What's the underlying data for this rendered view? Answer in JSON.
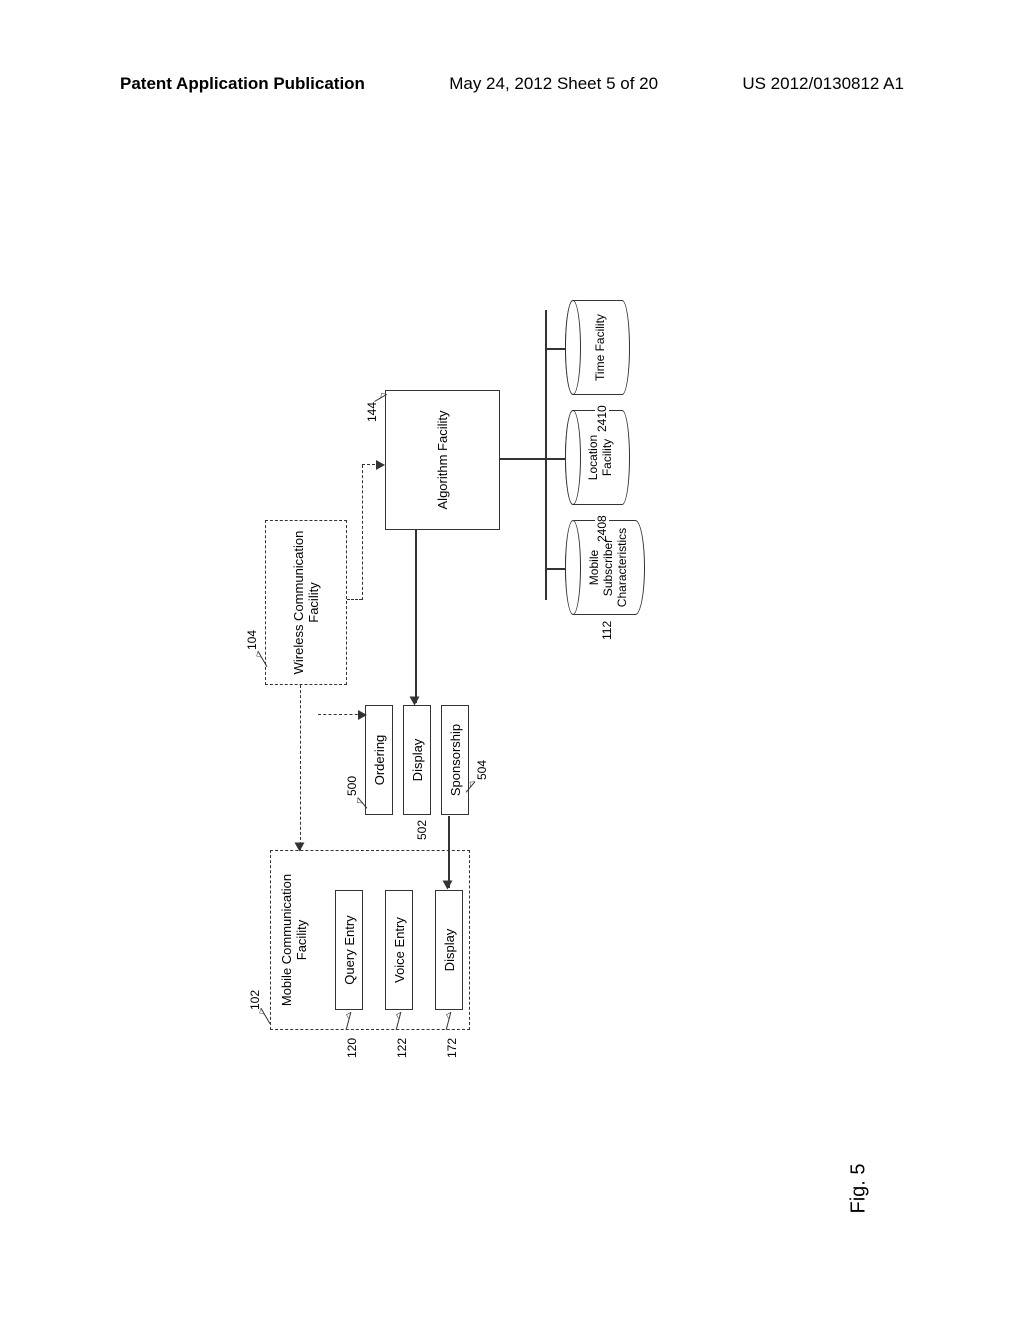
{
  "header": {
    "left": "Patent Application Publication",
    "center": "May 24, 2012  Sheet 5 of 20",
    "right": "US 2012/0130812 A1"
  },
  "figure_label": "Fig. 5",
  "blocks": {
    "mcf": {
      "title": "Mobile Communication Facility",
      "ref": "102"
    },
    "query_entry": {
      "title": "Query Entry",
      "ref": "120"
    },
    "voice_entry": {
      "title": "Voice Entry",
      "ref": "122"
    },
    "display_left": {
      "title": "Display",
      "ref": "172"
    },
    "ordering": {
      "title": "Ordering",
      "ref": "500"
    },
    "display_mid": {
      "title": "Display",
      "ref": "502"
    },
    "sponsorship": {
      "title": "Sponsorship",
      "ref": "504"
    },
    "wcf": {
      "title": "Wireless Communication Facility",
      "ref": "104"
    },
    "algorithm": {
      "title": "Algorithm Facility",
      "ref": "144"
    },
    "msc": {
      "title": "Mobile Subscriber Characteristics",
      "ref": "112"
    },
    "location": {
      "title": "Location Facility",
      "ref": "2408"
    },
    "time": {
      "title": "Time Facility",
      "ref": "2410"
    }
  }
}
